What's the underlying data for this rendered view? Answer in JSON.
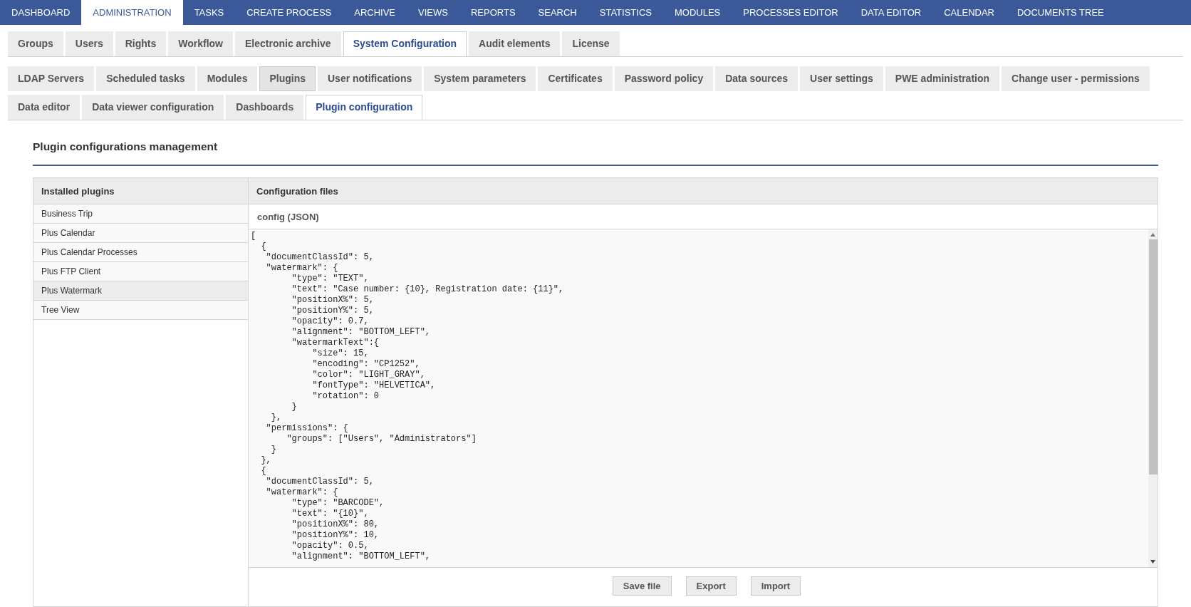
{
  "top_nav": [
    {
      "label": "DASHBOARD",
      "selected": false
    },
    {
      "label": "ADMINISTRATION",
      "selected": true
    },
    {
      "label": "TASKS",
      "selected": false
    },
    {
      "label": "CREATE PROCESS",
      "selected": false
    },
    {
      "label": "ARCHIVE",
      "selected": false
    },
    {
      "label": "VIEWS",
      "selected": false
    },
    {
      "label": "REPORTS",
      "selected": false
    },
    {
      "label": "SEARCH",
      "selected": false
    },
    {
      "label": "STATISTICS",
      "selected": false
    },
    {
      "label": "MODULES",
      "selected": false
    },
    {
      "label": "PROCESSES EDITOR",
      "selected": false
    },
    {
      "label": "DATA EDITOR",
      "selected": false
    },
    {
      "label": "CALENDAR",
      "selected": false
    },
    {
      "label": "DOCUMENTS TREE",
      "selected": false
    }
  ],
  "admin_tabs": [
    {
      "label": "Groups",
      "selected": false
    },
    {
      "label": "Users",
      "selected": false
    },
    {
      "label": "Rights",
      "selected": false
    },
    {
      "label": "Workflow",
      "selected": false
    },
    {
      "label": "Electronic archive",
      "selected": false
    },
    {
      "label": "System Configuration",
      "selected": true
    },
    {
      "label": "Audit elements",
      "selected": false
    },
    {
      "label": "License",
      "selected": false
    }
  ],
  "config_tabs": [
    {
      "label": "LDAP Servers",
      "selected": false,
      "highlighted": false
    },
    {
      "label": "Scheduled tasks",
      "selected": false,
      "highlighted": false
    },
    {
      "label": "Modules",
      "selected": false,
      "highlighted": false
    },
    {
      "label": "Plugins",
      "selected": false,
      "highlighted": true
    },
    {
      "label": "User notifications",
      "selected": false,
      "highlighted": false
    },
    {
      "label": "System parameters",
      "selected": false,
      "highlighted": false
    },
    {
      "label": "Certificates",
      "selected": false,
      "highlighted": false
    },
    {
      "label": "Password policy",
      "selected": false,
      "highlighted": false
    },
    {
      "label": "Data sources",
      "selected": false,
      "highlighted": false
    },
    {
      "label": "User settings",
      "selected": false,
      "highlighted": false
    },
    {
      "label": "PWE administration",
      "selected": false,
      "highlighted": false
    },
    {
      "label": "Change user - permissions",
      "selected": false,
      "highlighted": false
    },
    {
      "label": "Data editor",
      "selected": false,
      "highlighted": false
    },
    {
      "label": "Data viewer configuration",
      "selected": false,
      "highlighted": false
    },
    {
      "label": "Dashboards",
      "selected": false,
      "highlighted": false
    },
    {
      "label": "Plugin configuration",
      "selected": true,
      "highlighted": false
    }
  ],
  "heading": "Plugin configurations management",
  "plugins": {
    "title": "Installed plugins",
    "items": [
      {
        "label": "Business Trip",
        "selected": false
      },
      {
        "label": "Plus Calendar",
        "selected": false
      },
      {
        "label": "Plus Calendar Processes",
        "selected": false
      },
      {
        "label": "Plus FTP Client",
        "selected": false
      },
      {
        "label": "Plus Watermark",
        "selected": true
      },
      {
        "label": "Tree View",
        "selected": false
      }
    ]
  },
  "config_files": {
    "title": "Configuration files",
    "file_title": "config (JSON)",
    "code_lines": [
      "[",
      "  {",
      "   \"documentClassId\": 5,",
      "   \"watermark\": {",
      "        \"type\": \"TEXT\",",
      "        \"text\": \"Case number: {10}, Registration date: {11}\",",
      "        \"positionX%\": 5,",
      "        \"positionY%\": 5,",
      "        \"opacity\": 0.7,",
      "        \"alignment\": \"BOTTOM_LEFT\",",
      "        \"watermarkText\":{",
      "            \"size\": 15,",
      "            \"encoding\": \"CP1252\",",
      "            \"color\": \"LIGHT_GRAY\",",
      "            \"fontType\": \"HELVETICA\",",
      "            \"rotation\": 0",
      "        }",
      "    },",
      "   \"permissions\": {",
      "       \"groups\": [\"Users\", \"Administrators\"]",
      "    }",
      "  },",
      "  {",
      "   \"documentClassId\": 5,",
      "   \"watermark\": {",
      "        \"type\": \"BARCODE\",",
      "        \"text\": \"{10}\",",
      "        \"positionX%\": 80,",
      "        \"positionY%\": 10,",
      "        \"opacity\": 0.5,",
      "        \"alignment\": \"BOTTOM_LEFT\","
    ],
    "buttons": [
      "Save file",
      "Export",
      "Import"
    ]
  }
}
